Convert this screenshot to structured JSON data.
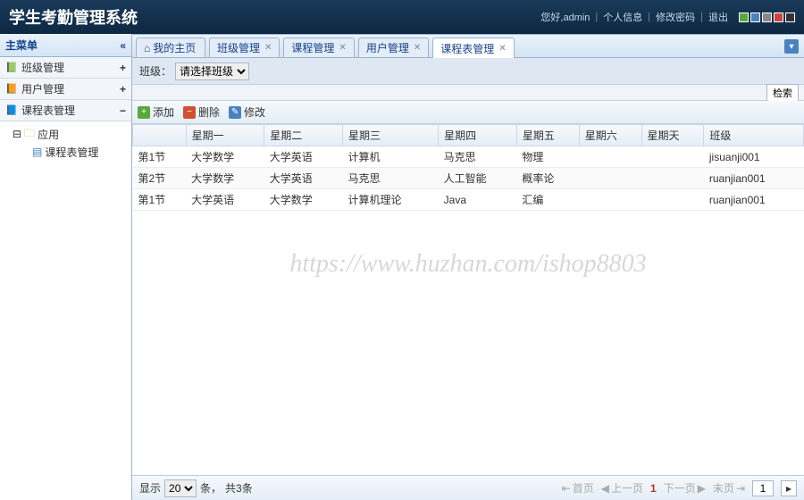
{
  "header": {
    "title": "学生考勤管理系统",
    "welcome": "您好,admin",
    "links": {
      "profile": "个人信息",
      "password": "修改密码",
      "logout": "退出"
    },
    "swatches": [
      "#5aa83a",
      "#4a82c0",
      "#888",
      "#c44",
      "#333"
    ]
  },
  "sidebar": {
    "title": "主菜单",
    "items": [
      {
        "label": "班级管理",
        "expand": "+"
      },
      {
        "label": "用户管理",
        "expand": "+"
      },
      {
        "label": "课程表管理",
        "expand": "−"
      }
    ],
    "tree": {
      "app": "应用",
      "leaf": "课程表管理"
    }
  },
  "tabs": {
    "list": [
      {
        "label": "我的主页",
        "close": false,
        "icon": "home"
      },
      {
        "label": "班级管理",
        "close": true
      },
      {
        "label": "课程管理",
        "close": true
      },
      {
        "label": "用户管理",
        "close": true
      },
      {
        "label": "课程表管理",
        "close": true,
        "active": true
      }
    ]
  },
  "filter": {
    "label": "班级：",
    "selected": "请选择班级"
  },
  "search_btn": "检索",
  "toolbar": {
    "add": "添加",
    "del": "删除",
    "edit": "修改"
  },
  "table": {
    "columns": [
      "",
      "星期一",
      "星期二",
      "星期三",
      "星期四",
      "星期五",
      "星期六",
      "星期天",
      "班级"
    ],
    "rows": [
      [
        "第1节",
        "大学数学",
        "大学英语",
        "计算机",
        "马克思",
        "物理",
        "",
        "",
        "jisuanji001"
      ],
      [
        "第2节",
        "大学数学",
        "大学英语",
        "马克思",
        "人工智能",
        "概率论",
        "",
        "",
        "ruanjian001"
      ],
      [
        "第1节",
        "大学英语",
        "大学数学",
        "计算机理论",
        "Java",
        "汇编",
        "",
        "",
        "ruanjian001"
      ]
    ]
  },
  "watermark": "https://www.huzhan.com/ishop8803",
  "pager": {
    "show": "显示",
    "per": "20",
    "unit": "条，",
    "total": "共3条",
    "first": "首页",
    "prev": "上一页",
    "cur": "1",
    "next": "下一页",
    "last": "末页",
    "page_input": "1"
  }
}
